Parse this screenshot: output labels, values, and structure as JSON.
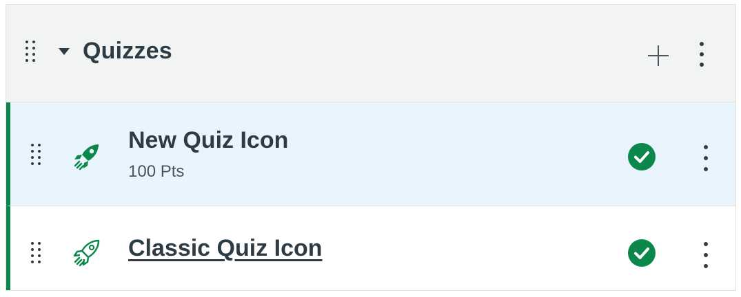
{
  "module": {
    "title": "Quizzes",
    "icons": {
      "drag": "drag-handle-icon",
      "collapse": "caret-down-icon",
      "add": "plus-icon",
      "menu": "kebab-menu-icon"
    }
  },
  "items": [
    {
      "title": "New Quiz Icon",
      "points": "100 Pts",
      "icon": "rocket-solid-icon",
      "status": "published-check-icon"
    },
    {
      "title": "Classic Quiz Icon",
      "icon": "rocket-outline-icon",
      "status": "published-check-icon"
    }
  ],
  "colors": {
    "accent": "#0b874b",
    "header_bg": "#f2f3f3",
    "active_row_bg": "#eaf4fc",
    "text": "#2d3b45"
  }
}
